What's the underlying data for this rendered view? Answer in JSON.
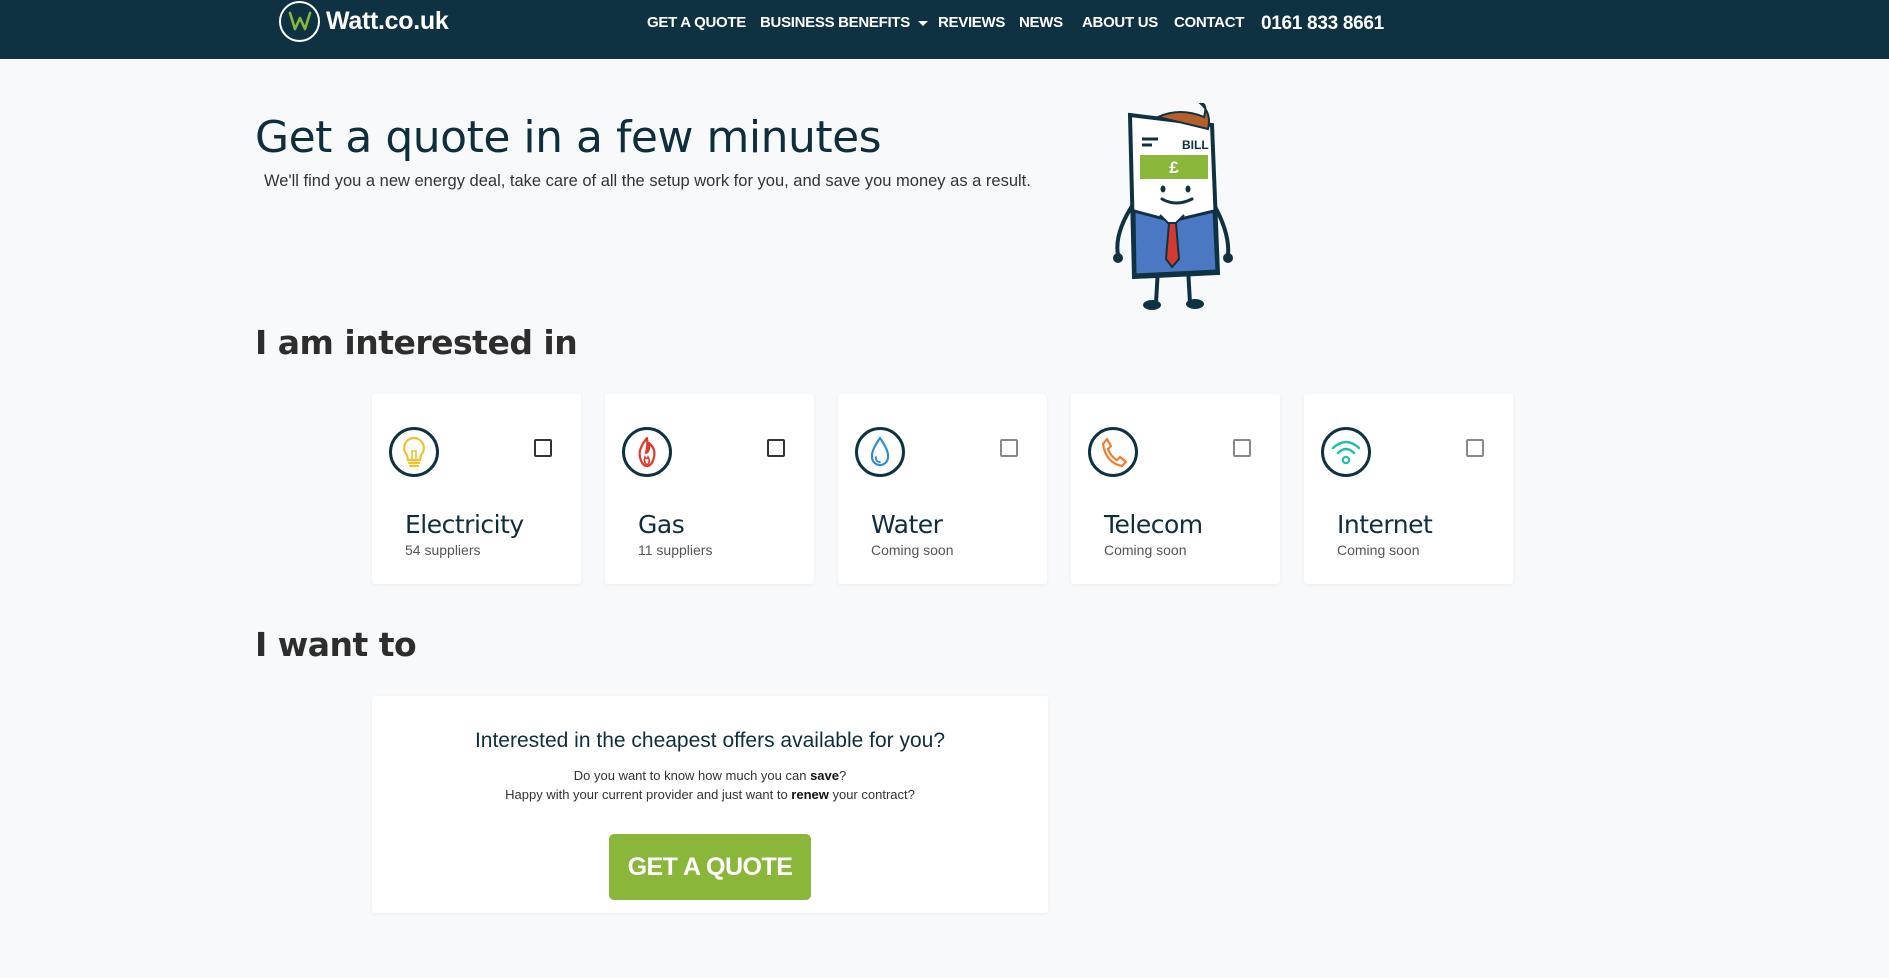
{
  "header": {
    "logo_text": "Watt.co.uk",
    "nav": [
      {
        "label": "GET A QUOTE"
      },
      {
        "label": "BUSINESS BENEFITS"
      },
      {
        "label": "REVIEWS"
      },
      {
        "label": "NEWS"
      },
      {
        "label": "ABOUT US"
      },
      {
        "label": "CONTACT"
      }
    ],
    "phone": "0161 833 8661"
  },
  "hero": {
    "title": "Get a quote in a few minutes",
    "subtitle": "We'll find you a new energy deal, take care of all the setup work for you, and save you money as a result.",
    "mascot": {
      "label": "BILL",
      "symbol": "£"
    }
  },
  "interest": {
    "heading": "I am interested in",
    "cards": [
      {
        "title": "Electricity",
        "subtitle": "54 suppliers",
        "icon": "lightbulb-icon",
        "color": "#f2c12e",
        "checked": false
      },
      {
        "title": "Gas",
        "subtitle": "11 suppliers",
        "icon": "flame-icon",
        "color": "#e03a2f",
        "checked": false
      },
      {
        "title": "Water",
        "subtitle": "Coming soon",
        "icon": "water-drop-icon",
        "color": "#2c8ed6",
        "checked": false
      },
      {
        "title": "Telecom",
        "subtitle": "Coming soon",
        "icon": "phone-icon",
        "color": "#f07d2a",
        "checked": false
      },
      {
        "title": "Internet",
        "subtitle": "Coming soon",
        "icon": "wifi-icon",
        "color": "#1fbfa8",
        "checked": false
      }
    ]
  },
  "want": {
    "heading": "I want to",
    "cta_heading": "Interested in the cheapest offers available for you?",
    "line1_pre": "Do you want to know how much you can ",
    "line1_bold": "save",
    "line1_post": "?",
    "line2_pre": "Happy with your current provider and just want to ",
    "line2_bold": "renew",
    "line2_post": " your contract?",
    "button": "GET A QUOTE"
  },
  "colors": {
    "navbar": "#0f3242",
    "accent_green": "#8ab63a",
    "background": "#f7f9fb"
  }
}
